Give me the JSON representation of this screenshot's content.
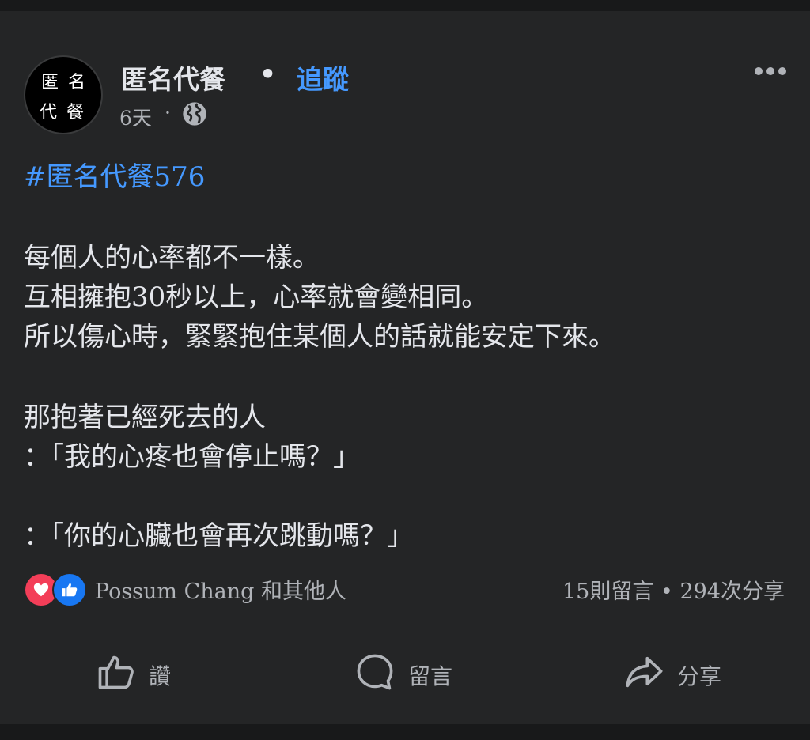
{
  "post": {
    "avatar_text": [
      "匿",
      "名",
      "代",
      "餐"
    ],
    "page_name": "匿名代餐",
    "separator": "•",
    "follow_label": "追蹤",
    "time": "6天",
    "meta_separator": "·",
    "privacy_icon": "globe-icon",
    "hashtag": "#匿名代餐576",
    "body_lines": [
      "每個人的心率都不一樣。",
      "互相擁抱30秒以上，心率就會變相同。",
      "所以傷心時，緊緊抱住某個人的話就能安定下來。",
      "那抱著已經死去的人",
      "：「我的心疼也會停止嗎？」",
      "：「你的心臟也會再次跳動嗎？」"
    ]
  },
  "reactions": {
    "icons": [
      "love-reaction-icon",
      "like-reaction-icon"
    ],
    "names": "Possum Chang 和其他人",
    "comments": "15則留言",
    "dot": "•",
    "shares": "294次分享"
  },
  "actions": {
    "like": "讚",
    "comment": "留言",
    "share": "分享"
  },
  "colors": {
    "background": "#242526",
    "link": "#4599ff",
    "text": "#e4e6eb",
    "secondary": "#b0b3b8",
    "love": "#f33e58",
    "like": "#1877f2"
  }
}
